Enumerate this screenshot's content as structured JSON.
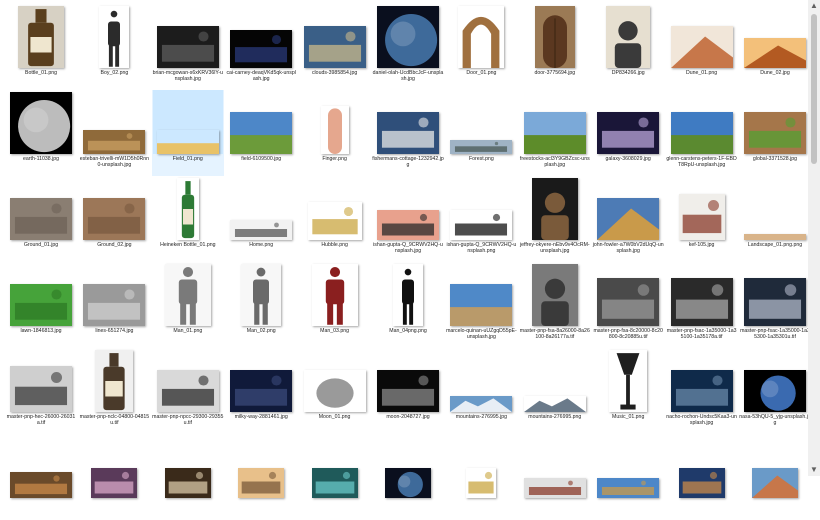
{
  "files": [
    {
      "name": "Bottle_01.png",
      "icon": "bottle",
      "w": 46,
      "h": 62,
      "bg": "#d7d1c4",
      "fg": "#5a3f1e"
    },
    {
      "name": "Boy_02.png",
      "icon": "person",
      "w": 30,
      "h": 62,
      "bg": "#ffffff",
      "fg": "#2b2b2b"
    },
    {
      "name": "brian-mcgowan-s6xKRV36lY-unsplash.jpg",
      "icon": "photo",
      "w": 62,
      "h": 42,
      "bg": "#1c1c1c",
      "fg": "#5c5c5c"
    },
    {
      "name": "cai-carney-deaqVKd5qk-unsplash.jpg",
      "icon": "photo",
      "w": 62,
      "h": 38,
      "bg": "#050505",
      "fg": "#2a3a7a"
    },
    {
      "name": "clouds-3985854.jpg",
      "icon": "photo",
      "w": 62,
      "h": 42,
      "bg": "#3a5f87",
      "fg": "#c9b88a"
    },
    {
      "name": "daniel-olah-UcdBbcJcF-unsplash.jpg",
      "icon": "planet",
      "w": 62,
      "h": 62,
      "bg": "#0a0f1e",
      "fg": "#3e6a9a"
    },
    {
      "name": "Door_01.png",
      "icon": "arch",
      "w": 46,
      "h": 62,
      "bg": "#ffffff",
      "fg": "#a0703f"
    },
    {
      "name": "door-3775694.jpg",
      "icon": "door",
      "w": 40,
      "h": 62,
      "bg": "#9b7a55",
      "fg": "#5b3820"
    },
    {
      "name": "DP834266.jpg",
      "icon": "portrait",
      "w": 44,
      "h": 62,
      "bg": "#e6dfd0",
      "fg": "#3a3a3a"
    },
    {
      "name": "Dune_01.png",
      "icon": "dune",
      "w": 62,
      "h": 42,
      "bg": "#f1e6d9",
      "fg": "#c7774a"
    },
    {
      "name": "Dune_02.jpg",
      "icon": "dune",
      "w": 62,
      "h": 30,
      "bg": "#f3c07a",
      "fg": "#b35a22"
    },
    {
      "name": "earth-11038.jpg",
      "icon": "earth",
      "w": 62,
      "h": 62,
      "bg": "#000000",
      "fg": "#bcbcbc"
    },
    {
      "name": "esteban-trivelli-mW1D5h0Rnn0-unsplash.jpg",
      "icon": "photo",
      "w": 62,
      "h": 24,
      "bg": "#8f6a3a",
      "fg": "#c9a063"
    },
    {
      "name": "Field_01.png",
      "icon": "field",
      "w": 62,
      "h": 24,
      "bg": "#cce8ff",
      "fg": "#e8c268",
      "selected": true
    },
    {
      "name": "field-6109500.jpg",
      "icon": "field",
      "w": 62,
      "h": 42,
      "bg": "#4d87c8",
      "fg": "#6c9b3a"
    },
    {
      "name": "Finger.png",
      "icon": "finger",
      "w": 28,
      "h": 48,
      "bg": "#ffffff",
      "fg": "#e5a78e"
    },
    {
      "name": "fishermans-cottage-1232942.jpg",
      "icon": "photo",
      "w": 62,
      "h": 42,
      "bg": "#2f4f7a",
      "fg": "#e8e8e8"
    },
    {
      "name": "Forest.png",
      "icon": "photo",
      "w": 62,
      "h": 14,
      "bg": "#9fb3c5",
      "fg": "#4a5a55"
    },
    {
      "name": "freestocks-acl3Y9GBZcsc-unsplash.jpg",
      "icon": "field",
      "w": 62,
      "h": 42,
      "bg": "#7ba9d8",
      "fg": "#5d8c2a"
    },
    {
      "name": "galaxy-3608029.jpg",
      "icon": "photo",
      "w": 62,
      "h": 42,
      "bg": "#1a1638",
      "fg": "#b9a6d8"
    },
    {
      "name": "glenn-carstens-peters-1F-EBDT8RpU-unsplash.jpg",
      "icon": "field",
      "w": 62,
      "h": 42,
      "bg": "#3f7bc2",
      "fg": "#5b8a30"
    },
    {
      "name": "global-3371528.jpg",
      "icon": "photo",
      "w": 62,
      "h": 42,
      "bg": "#a5764a",
      "fg": "#54a033"
    },
    {
      "name": "Ground_01.jpg",
      "icon": "photo",
      "w": 62,
      "h": 42,
      "bg": "#8a7e72",
      "fg": "#6e6358"
    },
    {
      "name": "Ground_02.jpg",
      "icon": "photo",
      "w": 62,
      "h": 42,
      "bg": "#9c7758",
      "fg": "#7a5a40"
    },
    {
      "name": "Heineken Bottle_01.png",
      "icon": "bottle",
      "w": 22,
      "h": 62,
      "bg": "#ffffff",
      "fg": "#2d7a35"
    },
    {
      "name": "Home.png",
      "icon": "photo",
      "w": 62,
      "h": 20,
      "bg": "#f2f2f2",
      "fg": "#555555"
    },
    {
      "name": "Hubble.png",
      "icon": "photo",
      "w": 54,
      "h": 38,
      "bg": "#ffffff",
      "fg": "#c9a640"
    },
    {
      "name": "ishan-gupta-Q_9CRWV2HQ-unsplash.jpg",
      "icon": "photo",
      "w": 62,
      "h": 30,
      "bg": "#e8a18d",
      "fg": "#2a2a2a"
    },
    {
      "name": "ishan-gupta-Q_9CRWV2HQ-unsplash.png",
      "icon": "photo",
      "w": 62,
      "h": 30,
      "bg": "#ffffff",
      "fg": "#111111"
    },
    {
      "name": "jeffrey-okyere-nEbv9v4OcRM-unsplash.jpg",
      "icon": "portrait",
      "w": 46,
      "h": 62,
      "bg": "#1a1a1a",
      "fg": "#7a5a3a"
    },
    {
      "name": "john-fowler-a7W0bV2dUqQ-unsplash.jpg",
      "icon": "dune",
      "w": 62,
      "h": 42,
      "bg": "#4d7bb5",
      "fg": "#c99a4a"
    },
    {
      "name": "kef-105.jpg",
      "icon": "photo",
      "w": 46,
      "h": 46,
      "bg": "#f0eeea",
      "fg": "#8a3a2a"
    },
    {
      "name": "Landscape_01.png.png",
      "icon": "photo",
      "w": 62,
      "h": 6,
      "bg": "#d9b48a",
      "fg": "#7a5a3a"
    },
    {
      "name": "lawn-1846813.jpg",
      "icon": "photo",
      "w": 62,
      "h": 42,
      "bg": "#46a33a",
      "fg": "#2d7a25"
    },
    {
      "name": "lines-651274.jpg",
      "icon": "photo",
      "w": 62,
      "h": 42,
      "bg": "#9a9a9a",
      "fg": "#cfcfcf"
    },
    {
      "name": "Man_01.png",
      "icon": "person",
      "w": 46,
      "h": 62,
      "bg": "#f7f7f7",
      "fg": "#7a7a7a"
    },
    {
      "name": "Man_02.png",
      "icon": "person",
      "w": 40,
      "h": 62,
      "bg": "#f7f7f7",
      "fg": "#6a6a6a"
    },
    {
      "name": "Man_03.png",
      "icon": "person",
      "w": 46,
      "h": 62,
      "bg": "#ffffff",
      "fg": "#8a1f1f"
    },
    {
      "name": "Man_04png.png",
      "icon": "person",
      "w": 30,
      "h": 62,
      "bg": "#ffffff",
      "fg": "#111111"
    },
    {
      "name": "marcelo-quinan-uUZgqD55pE-unsplash.jpg",
      "icon": "field",
      "w": 62,
      "h": 42,
      "bg": "#4f89c8",
      "fg": "#b99a6a"
    },
    {
      "name": "master-pnp-fsa-8a26000-8a26100-8a26177a.tif",
      "icon": "portrait",
      "w": 46,
      "h": 62,
      "bg": "#7a7a7a",
      "fg": "#3a3a3a"
    },
    {
      "name": "master-pnp-fsa-8c20000-8c20800-8c20885u.tif",
      "icon": "photo",
      "w": 62,
      "h": 48,
      "bg": "#4a4a4a",
      "fg": "#9a9a9a"
    },
    {
      "name": "master-pnp-fsac-1a35000-1a35100-1a35178a.tif",
      "icon": "photo",
      "w": 62,
      "h": 48,
      "bg": "#2a2a2a",
      "fg": "#a8a8a8"
    },
    {
      "name": "master-pnp-fsac-1a35000-1a35300-1a35301u.tif",
      "icon": "photo",
      "w": 62,
      "h": 48,
      "bg": "#1f2a3a",
      "fg": "#b0b8c8"
    },
    {
      "name": "master-pnp-hec-26000-26031a.tif",
      "icon": "photo",
      "w": 62,
      "h": 46,
      "bg": "#cfcfcf",
      "fg": "#3a3a3a"
    },
    {
      "name": "master-pnp-nclc-04800-04815u.tif",
      "icon": "bottle",
      "w": 38,
      "h": 62,
      "bg": "#f0f0f0",
      "fg": "#4a3a2a"
    },
    {
      "name": "master-pnp-npcc-29300-29355u.tif",
      "icon": "photo",
      "w": 62,
      "h": 42,
      "bg": "#d9d9d9",
      "fg": "#2a2a2a"
    },
    {
      "name": "milky-way-2881461.jpg",
      "icon": "photo",
      "w": 62,
      "h": 42,
      "bg": "#101a3a",
      "fg": "#3a4a7a"
    },
    {
      "name": "Moon_01.png",
      "icon": "moon",
      "w": 62,
      "h": 42,
      "bg": "#ffffff",
      "fg": "#9a9a9a"
    },
    {
      "name": "moon-2048727.jpg",
      "icon": "photo",
      "w": 62,
      "h": 42,
      "bg": "#0a0a0a",
      "fg": "#8a8a8a"
    },
    {
      "name": "mountains-276995.jpg",
      "icon": "mountain",
      "w": 62,
      "h": 16,
      "bg": "#6a9ac8",
      "fg": "#e8eef5"
    },
    {
      "name": "mountains-276995.png",
      "icon": "mountain",
      "w": 62,
      "h": 16,
      "bg": "#ffffff",
      "fg": "#6a7a8a"
    },
    {
      "name": "Music_01.png",
      "icon": "speaker",
      "w": 38,
      "h": 62,
      "bg": "#ffffff",
      "fg": "#1f1f1f"
    },
    {
      "name": "nacho-rochon-Undsc5Kaa3-unsplash.jpg",
      "icon": "photo",
      "w": 62,
      "h": 42,
      "bg": "#0f2a4a",
      "fg": "#6a8aaa"
    },
    {
      "name": "nasa-53hQU-5_yjg-unsplash.jpg",
      "icon": "earth",
      "w": 62,
      "h": 42,
      "bg": "#000000",
      "fg": "#3a6ab0"
    },
    {
      "name": "",
      "icon": "photo",
      "w": 62,
      "h": 26,
      "bg": "#6a4a2a",
      "fg": "#c98a4a"
    },
    {
      "name": "",
      "icon": "photo",
      "w": 46,
      "h": 30,
      "bg": "#5a3a5a",
      "fg": "#d9a8c8"
    },
    {
      "name": "",
      "icon": "photo",
      "w": 46,
      "h": 30,
      "bg": "#3a2a1a",
      "fg": "#d9c8a8"
    },
    {
      "name": "",
      "icon": "photo",
      "w": 46,
      "h": 30,
      "bg": "#e8c08a",
      "fg": "#7a5a3a"
    },
    {
      "name": "",
      "icon": "photo",
      "w": 46,
      "h": 30,
      "bg": "#1f5a5a",
      "fg": "#6ac8c8"
    },
    {
      "name": "",
      "icon": "planet",
      "w": 46,
      "h": 30,
      "bg": "#0a0f1e",
      "fg": "#3e6a9a"
    },
    {
      "name": "",
      "icon": "photo",
      "w": 30,
      "h": 30,
      "bg": "#ffffff",
      "fg": "#c9a640"
    },
    {
      "name": "",
      "icon": "photo",
      "w": 62,
      "h": 20,
      "bg": "#e0e0e0",
      "fg": "#8a3a2a"
    },
    {
      "name": "",
      "icon": "photo",
      "w": 62,
      "h": 20,
      "bg": "#4d87c8",
      "fg": "#c99a4a"
    },
    {
      "name": "",
      "icon": "photo",
      "w": 46,
      "h": 30,
      "bg": "#1f3a6a",
      "fg": "#c98a4a"
    },
    {
      "name": "",
      "icon": "dune",
      "w": 46,
      "h": 30,
      "bg": "#6a9ac8",
      "fg": "#c7774a"
    }
  ]
}
